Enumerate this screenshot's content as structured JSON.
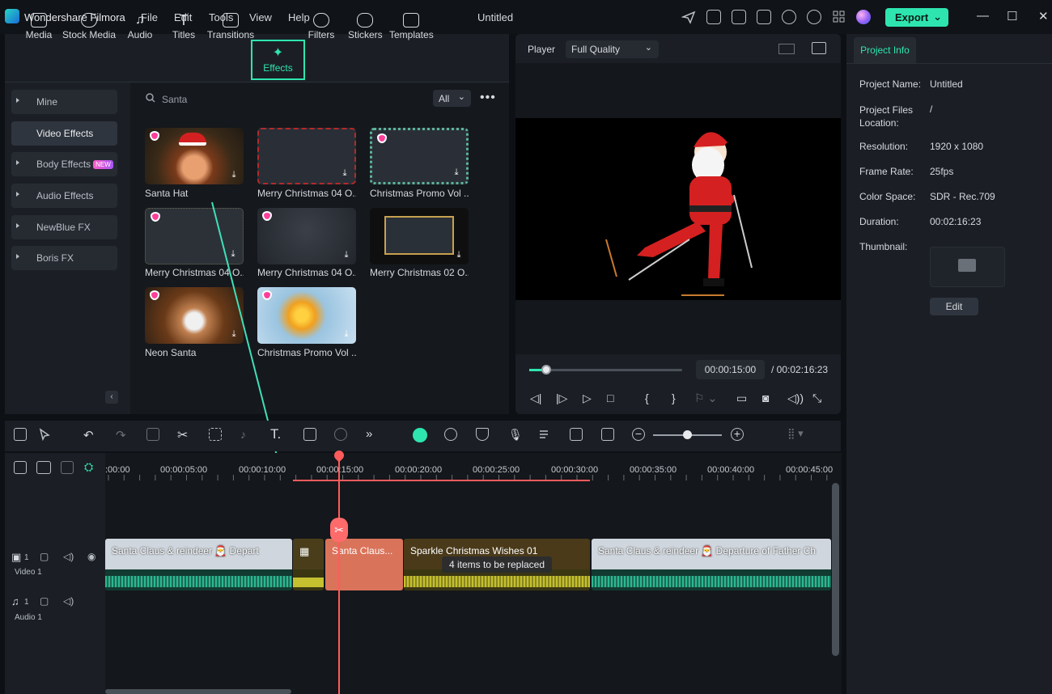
{
  "app": {
    "name": "Wondershare Filmora",
    "window_title": "Untitled"
  },
  "menu": [
    "File",
    "Edit",
    "Tools",
    "View",
    "Help"
  ],
  "export": {
    "label": "Export"
  },
  "tabs": [
    "Media",
    "Stock Media",
    "Audio",
    "Titles",
    "Transitions",
    "Effects",
    "Filters",
    "Stickers",
    "Templates"
  ],
  "active_tab": "Effects",
  "sidebar": {
    "items": [
      {
        "label": "Mine"
      },
      {
        "label": "Video Effects"
      },
      {
        "label": "Body Effects",
        "badge": "NEW"
      },
      {
        "label": "Audio Effects"
      },
      {
        "label": "NewBlue FX"
      },
      {
        "label": "Boris FX"
      }
    ]
  },
  "search": {
    "value": "Santa",
    "filter": "All"
  },
  "effects": [
    {
      "label": "Santa Hat"
    },
    {
      "label": "Merry Christmas 04 O..."
    },
    {
      "label": "Christmas Promo Vol ..."
    },
    {
      "label": "Merry Christmas 04 O..."
    },
    {
      "label": "Merry Christmas 04 O..."
    },
    {
      "label": "Merry Christmas 02 O..."
    },
    {
      "label": "Neon Santa"
    },
    {
      "label": "Christmas Promo Vol ..."
    }
  ],
  "player": {
    "label": "Player",
    "quality": "Full Quality",
    "current_time": "00:00:15:00",
    "total_time": "/ 00:02:16:23",
    "progress": 0.11
  },
  "project_info": {
    "tab": "Project Info",
    "rows": [
      {
        "label": "Project Name:",
        "value": "Untitled"
      },
      {
        "label": "Project Files Location:",
        "value": "/"
      },
      {
        "label": "Resolution:",
        "value": "1920 x 1080"
      },
      {
        "label": "Frame Rate:",
        "value": "25fps"
      },
      {
        "label": "Color Space:",
        "value": "SDR - Rec.709"
      },
      {
        "label": "Duration:",
        "value": "00:02:16:23"
      },
      {
        "label": "Thumbnail:",
        "value": ""
      }
    ],
    "edit_label": "Edit"
  },
  "timeline": {
    "ticks": [
      ":00:00",
      "00:00:05:00",
      "00:00:10:00",
      "00:00:15:00",
      "00:00:20:00",
      "00:00:25:00",
      "00:00:30:00",
      "00:00:35:00",
      "00:00:40:00",
      "00:00:45:00"
    ],
    "tracks": [
      {
        "label": "Video 1",
        "num": "1"
      },
      {
        "label": "Audio 1",
        "num": "1"
      }
    ],
    "clips": [
      {
        "label": "Santa Claus & reindeer 🎅 Depart"
      },
      {
        "label": ""
      },
      {
        "label": "Santa Claus..."
      },
      {
        "label": "Sparkle Christmas Wishes 01"
      },
      {
        "label": "Santa Claus & reindeer 🎅 Departure of Father Ch"
      }
    ],
    "replace_note": "4 items to be replaced"
  },
  "colors": {
    "accent": "#2ee5b0",
    "playhead": "#ff5b5b",
    "clip_selected": "#d9735a"
  }
}
